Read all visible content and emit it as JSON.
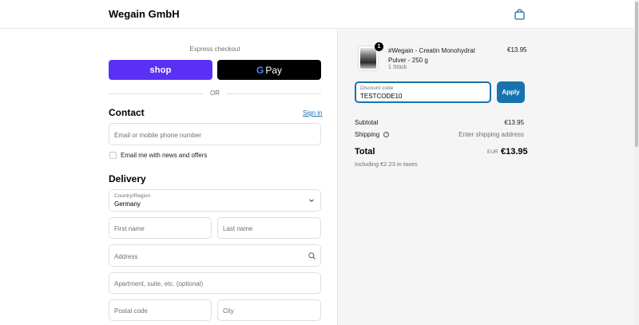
{
  "header": {
    "brand": "Wegain GmbH",
    "cart_icon": "bag-icon"
  },
  "express": {
    "label": "Express checkout",
    "shop_label": "shop",
    "gpay_g": "G",
    "gpay_label": "Pay",
    "or": "OR"
  },
  "contact": {
    "title": "Contact",
    "sign_in": "Sign in",
    "email_placeholder": "Email or mobile phone number",
    "newsletter_label": "Email me with news and offers"
  },
  "delivery": {
    "title": "Delivery",
    "country_label": "Country/Region",
    "country_value": "Germany",
    "first_name": "First name",
    "last_name": "Last name",
    "address": "Address",
    "apartment": "Apartment, suite, etc. (optional)",
    "postal_code": "Postal code",
    "city": "City"
  },
  "order": {
    "product": {
      "name": "#Wegain - Creatin Monohydrat Pulver - 250 g",
      "qty_text": "1 Stück",
      "qty_badge": "1",
      "price": "€13.95"
    },
    "discount": {
      "label": "Discount code",
      "value": "TESTCODE10",
      "apply": "Apply"
    },
    "subtotal_label": "Subtotal",
    "subtotal_value": "€13.95",
    "shipping_label": "Shipping",
    "shipping_value": "Enter shipping address",
    "total_label": "Total",
    "total_currency": "EUR",
    "total_value": "€13.95",
    "tax_note": "Including €2.23 in taxes"
  },
  "colors": {
    "accent": "#1773b0",
    "shop_pay": "#5a31f4",
    "gpay_bg": "#000000"
  }
}
